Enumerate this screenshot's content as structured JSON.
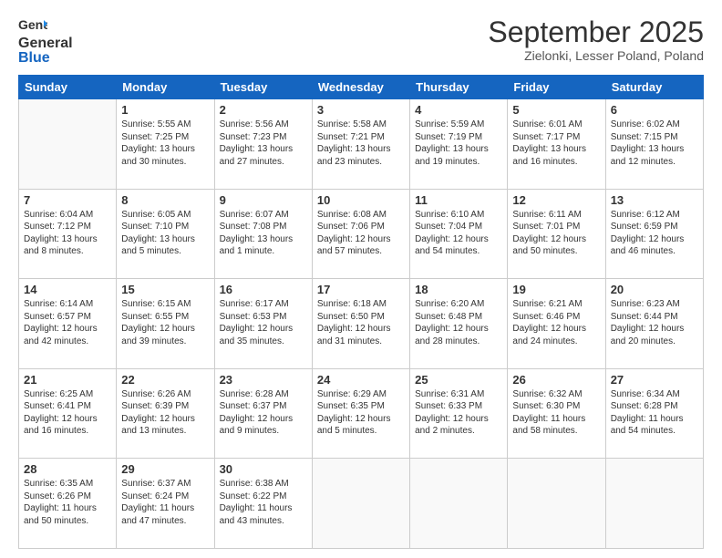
{
  "logo": {
    "line1": "General",
    "line2": "Blue"
  },
  "header": {
    "month": "September 2025",
    "location": "Zielonki, Lesser Poland, Poland"
  },
  "weekdays": [
    "Sunday",
    "Monday",
    "Tuesday",
    "Wednesday",
    "Thursday",
    "Friday",
    "Saturday"
  ],
  "weeks": [
    [
      {
        "day": "",
        "text": ""
      },
      {
        "day": "1",
        "text": "Sunrise: 5:55 AM\nSunset: 7:25 PM\nDaylight: 13 hours\nand 30 minutes."
      },
      {
        "day": "2",
        "text": "Sunrise: 5:56 AM\nSunset: 7:23 PM\nDaylight: 13 hours\nand 27 minutes."
      },
      {
        "day": "3",
        "text": "Sunrise: 5:58 AM\nSunset: 7:21 PM\nDaylight: 13 hours\nand 23 minutes."
      },
      {
        "day": "4",
        "text": "Sunrise: 5:59 AM\nSunset: 7:19 PM\nDaylight: 13 hours\nand 19 minutes."
      },
      {
        "day": "5",
        "text": "Sunrise: 6:01 AM\nSunset: 7:17 PM\nDaylight: 13 hours\nand 16 minutes."
      },
      {
        "day": "6",
        "text": "Sunrise: 6:02 AM\nSunset: 7:15 PM\nDaylight: 13 hours\nand 12 minutes."
      }
    ],
    [
      {
        "day": "7",
        "text": "Sunrise: 6:04 AM\nSunset: 7:12 PM\nDaylight: 13 hours\nand 8 minutes."
      },
      {
        "day": "8",
        "text": "Sunrise: 6:05 AM\nSunset: 7:10 PM\nDaylight: 13 hours\nand 5 minutes."
      },
      {
        "day": "9",
        "text": "Sunrise: 6:07 AM\nSunset: 7:08 PM\nDaylight: 13 hours\nand 1 minute."
      },
      {
        "day": "10",
        "text": "Sunrise: 6:08 AM\nSunset: 7:06 PM\nDaylight: 12 hours\nand 57 minutes."
      },
      {
        "day": "11",
        "text": "Sunrise: 6:10 AM\nSunset: 7:04 PM\nDaylight: 12 hours\nand 54 minutes."
      },
      {
        "day": "12",
        "text": "Sunrise: 6:11 AM\nSunset: 7:01 PM\nDaylight: 12 hours\nand 50 minutes."
      },
      {
        "day": "13",
        "text": "Sunrise: 6:12 AM\nSunset: 6:59 PM\nDaylight: 12 hours\nand 46 minutes."
      }
    ],
    [
      {
        "day": "14",
        "text": "Sunrise: 6:14 AM\nSunset: 6:57 PM\nDaylight: 12 hours\nand 42 minutes."
      },
      {
        "day": "15",
        "text": "Sunrise: 6:15 AM\nSunset: 6:55 PM\nDaylight: 12 hours\nand 39 minutes."
      },
      {
        "day": "16",
        "text": "Sunrise: 6:17 AM\nSunset: 6:53 PM\nDaylight: 12 hours\nand 35 minutes."
      },
      {
        "day": "17",
        "text": "Sunrise: 6:18 AM\nSunset: 6:50 PM\nDaylight: 12 hours\nand 31 minutes."
      },
      {
        "day": "18",
        "text": "Sunrise: 6:20 AM\nSunset: 6:48 PM\nDaylight: 12 hours\nand 28 minutes."
      },
      {
        "day": "19",
        "text": "Sunrise: 6:21 AM\nSunset: 6:46 PM\nDaylight: 12 hours\nand 24 minutes."
      },
      {
        "day": "20",
        "text": "Sunrise: 6:23 AM\nSunset: 6:44 PM\nDaylight: 12 hours\nand 20 minutes."
      }
    ],
    [
      {
        "day": "21",
        "text": "Sunrise: 6:25 AM\nSunset: 6:41 PM\nDaylight: 12 hours\nand 16 minutes."
      },
      {
        "day": "22",
        "text": "Sunrise: 6:26 AM\nSunset: 6:39 PM\nDaylight: 12 hours\nand 13 minutes."
      },
      {
        "day": "23",
        "text": "Sunrise: 6:28 AM\nSunset: 6:37 PM\nDaylight: 12 hours\nand 9 minutes."
      },
      {
        "day": "24",
        "text": "Sunrise: 6:29 AM\nSunset: 6:35 PM\nDaylight: 12 hours\nand 5 minutes."
      },
      {
        "day": "25",
        "text": "Sunrise: 6:31 AM\nSunset: 6:33 PM\nDaylight: 12 hours\nand 2 minutes."
      },
      {
        "day": "26",
        "text": "Sunrise: 6:32 AM\nSunset: 6:30 PM\nDaylight: 11 hours\nand 58 minutes."
      },
      {
        "day": "27",
        "text": "Sunrise: 6:34 AM\nSunset: 6:28 PM\nDaylight: 11 hours\nand 54 minutes."
      }
    ],
    [
      {
        "day": "28",
        "text": "Sunrise: 6:35 AM\nSunset: 6:26 PM\nDaylight: 11 hours\nand 50 minutes."
      },
      {
        "day": "29",
        "text": "Sunrise: 6:37 AM\nSunset: 6:24 PM\nDaylight: 11 hours\nand 47 minutes."
      },
      {
        "day": "30",
        "text": "Sunrise: 6:38 AM\nSunset: 6:22 PM\nDaylight: 11 hours\nand 43 minutes."
      },
      {
        "day": "",
        "text": ""
      },
      {
        "day": "",
        "text": ""
      },
      {
        "day": "",
        "text": ""
      },
      {
        "day": "",
        "text": ""
      }
    ]
  ]
}
